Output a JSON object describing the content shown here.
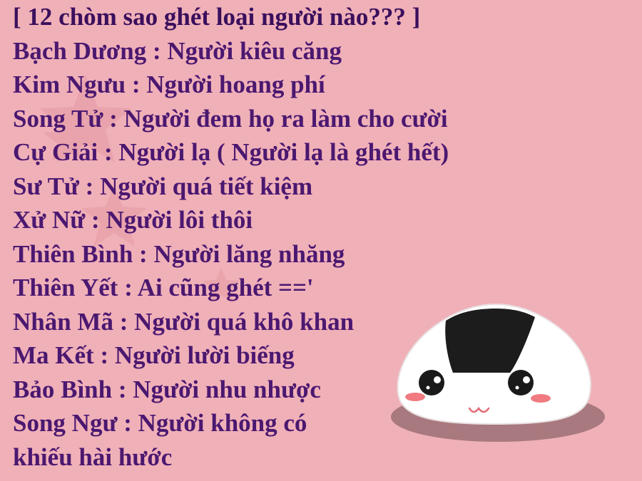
{
  "title": "[ 12 chòm sao ghét loại người nào??? ]",
  "lines": [
    "Bạch Dương : Người kiêu căng",
    "Kim Ngưu : Người hoang phí",
    "Song Tử : Người đem họ ra làm cho cười",
    "Cự Giải : Người lạ ( Người lạ là ghét hết)",
    "Sư Tử : Người quá tiết kiệm",
    "Xử Nữ : Người lôi thôi",
    "Thiên Bình : Người lăng nhăng",
    "Thiên Yết : Ai cũng ghét =='",
    "Nhân Mã : Người quá khô khan",
    "Ma Kết : Người lười biếng",
    "Bảo Bình : Người nhu nhược",
    "Song Ngư : Người không có",
    "khiếu hài hước"
  ],
  "colors": {
    "background": "#f0b0b8",
    "text": "#4b1870",
    "star": "#d98a93",
    "mascot_body": "#ffffff",
    "mascot_seaweed": "#1a1a1a",
    "mascot_blush": "#f07a80",
    "mascot_shadow": "#a8797e"
  },
  "decorations": {
    "background_stars": "faded-star-shapes",
    "mascot": "rice-ball-mascot"
  }
}
